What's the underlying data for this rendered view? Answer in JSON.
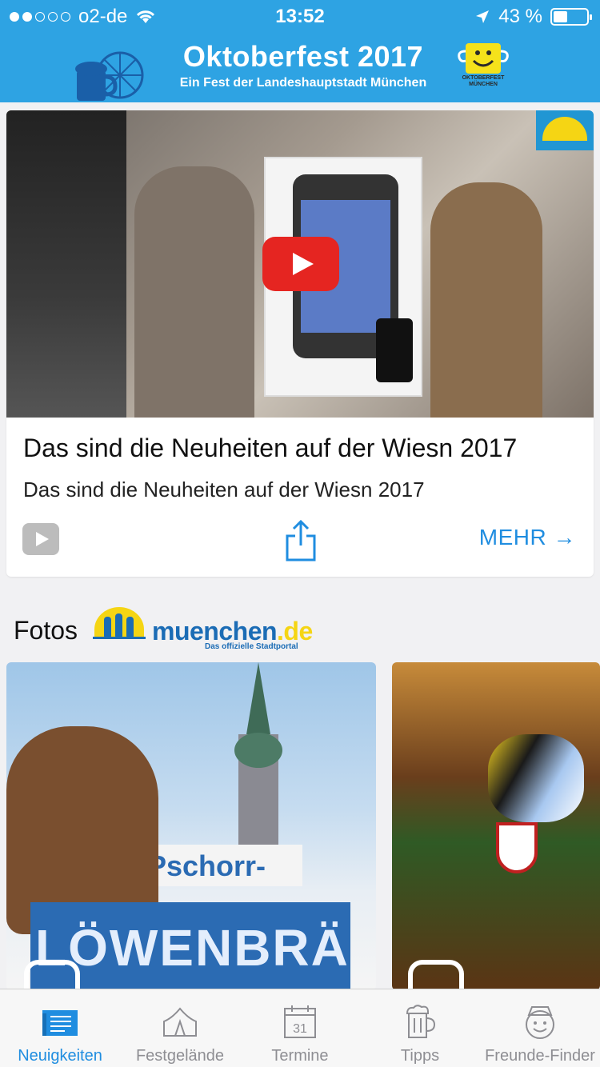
{
  "status_bar": {
    "carrier": "o2-de",
    "time": "13:52",
    "battery_percent": "43 %",
    "battery_level": 0.43
  },
  "header": {
    "title": "Oktoberfest 2017",
    "subtitle": "Ein Fest der Landeshauptstadt München",
    "badge_text": "OKTOBERFEST MÜNCHEN"
  },
  "card": {
    "title": "Das sind die Neuheiten auf der Wiesn 2017",
    "subtitle": "Das sind die Neuheiten auf der Wiesn 2017",
    "more_label": "MEHR →"
  },
  "fotos": {
    "title": "Fotos",
    "logo_word": "muenchen",
    "logo_tld": ".de",
    "logo_tagline": "Das offizielle Stadtportal",
    "photo1_sign_top": "Pschorr-",
    "photo1_sign_bottom": "LÖWENBRÄ"
  },
  "tabs": [
    {
      "label": "Neuigkeiten",
      "icon": "news-icon",
      "active": true
    },
    {
      "label": "Festgelände",
      "icon": "tent-icon",
      "active": false
    },
    {
      "label": "Termine",
      "icon": "calendar-icon",
      "calendar_day": "31",
      "active": false
    },
    {
      "label": "Tipps",
      "icon": "beer-mug-icon",
      "active": false
    },
    {
      "label": "Freunde-Finder",
      "icon": "friend-face-icon",
      "active": false
    }
  ],
  "colors": {
    "header_blue": "#2ea3e3",
    "accent_blue": "#1f8de0",
    "youtube_red": "#e52521",
    "muenchen_yellow": "#f5d514",
    "muenchen_blue": "#1b6cb5"
  }
}
